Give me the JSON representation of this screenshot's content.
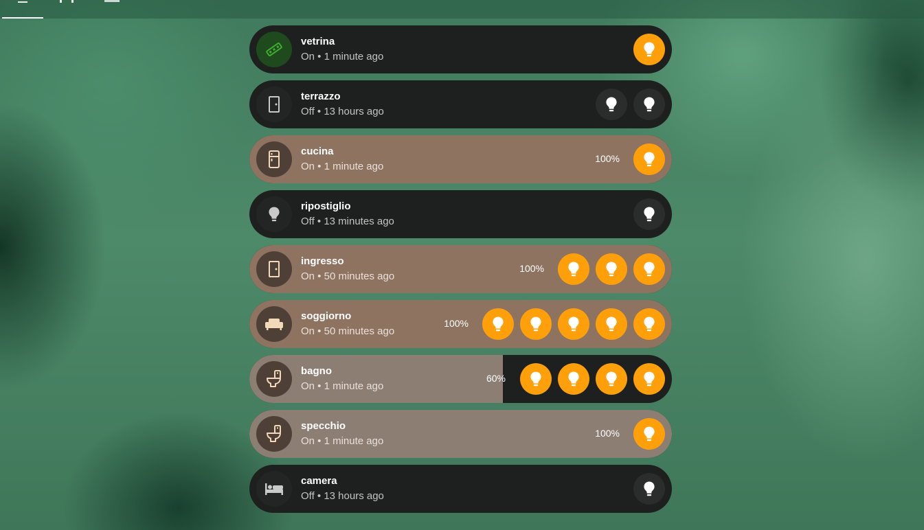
{
  "tabs": [
    {
      "name": "overview-tab",
      "active": true
    },
    {
      "name": "tab-2",
      "active": false
    },
    {
      "name": "tab-3",
      "active": false
    }
  ],
  "colors": {
    "bulb_on": "#ff9f0a",
    "bulb_off": "#2b2c2c",
    "row_dark": "#1e1f1f",
    "row_warm": "#8e7360",
    "row_grey": "#8d7e74"
  },
  "rooms": [
    {
      "name": "vetrina",
      "status": "On • 1 minute ago",
      "icon": "led-strip-icon",
      "style": "dark",
      "brightness_text": "",
      "fill": 0,
      "bulbs": [
        "on"
      ]
    },
    {
      "name": "terrazzo",
      "status": "Off • 13 hours ago",
      "icon": "door-icon",
      "style": "dark",
      "brightness_text": "",
      "fill": 0,
      "bulbs": [
        "off",
        "off"
      ]
    },
    {
      "name": "cucina",
      "status": "On • 1 minute ago",
      "icon": "fridge-icon",
      "style": "warm",
      "brightness_text": "100%",
      "fill": 1.0,
      "bulbs": [
        "on"
      ]
    },
    {
      "name": "ripostiglio",
      "status": "Off • 13 minutes ago",
      "icon": "lightbulb-icon",
      "style": "dark",
      "brightness_text": "",
      "fill": 0,
      "bulbs": [
        "off"
      ]
    },
    {
      "name": "ingresso",
      "status": "On • 50 minutes ago",
      "icon": "door-icon",
      "style": "warm",
      "brightness_text": "100%",
      "fill": 1.0,
      "bulbs": [
        "on",
        "on",
        "on"
      ]
    },
    {
      "name": "soggiorno",
      "status": "On • 50 minutes ago",
      "icon": "sofa-icon",
      "style": "warm",
      "brightness_text": "100%",
      "fill": 1.0,
      "bulbs": [
        "on",
        "on",
        "on",
        "on",
        "on"
      ]
    },
    {
      "name": "bagno",
      "status": "On • 1 minute ago",
      "icon": "toilet-icon",
      "style": "grey",
      "brightness_text": "60%",
      "fill": 0.6,
      "bulbs": [
        "on",
        "on",
        "on",
        "on"
      ]
    },
    {
      "name": "specchio",
      "status": "On • 1 minute ago",
      "icon": "toilet-icon",
      "style": "grey",
      "brightness_text": "100%",
      "fill": 1.0,
      "bulbs": [
        "on"
      ]
    },
    {
      "name": "camera",
      "status": "Off • 13 hours ago",
      "icon": "bed-icon",
      "style": "dark",
      "brightness_text": "",
      "fill": 0,
      "bulbs": [
        "off"
      ]
    }
  ]
}
